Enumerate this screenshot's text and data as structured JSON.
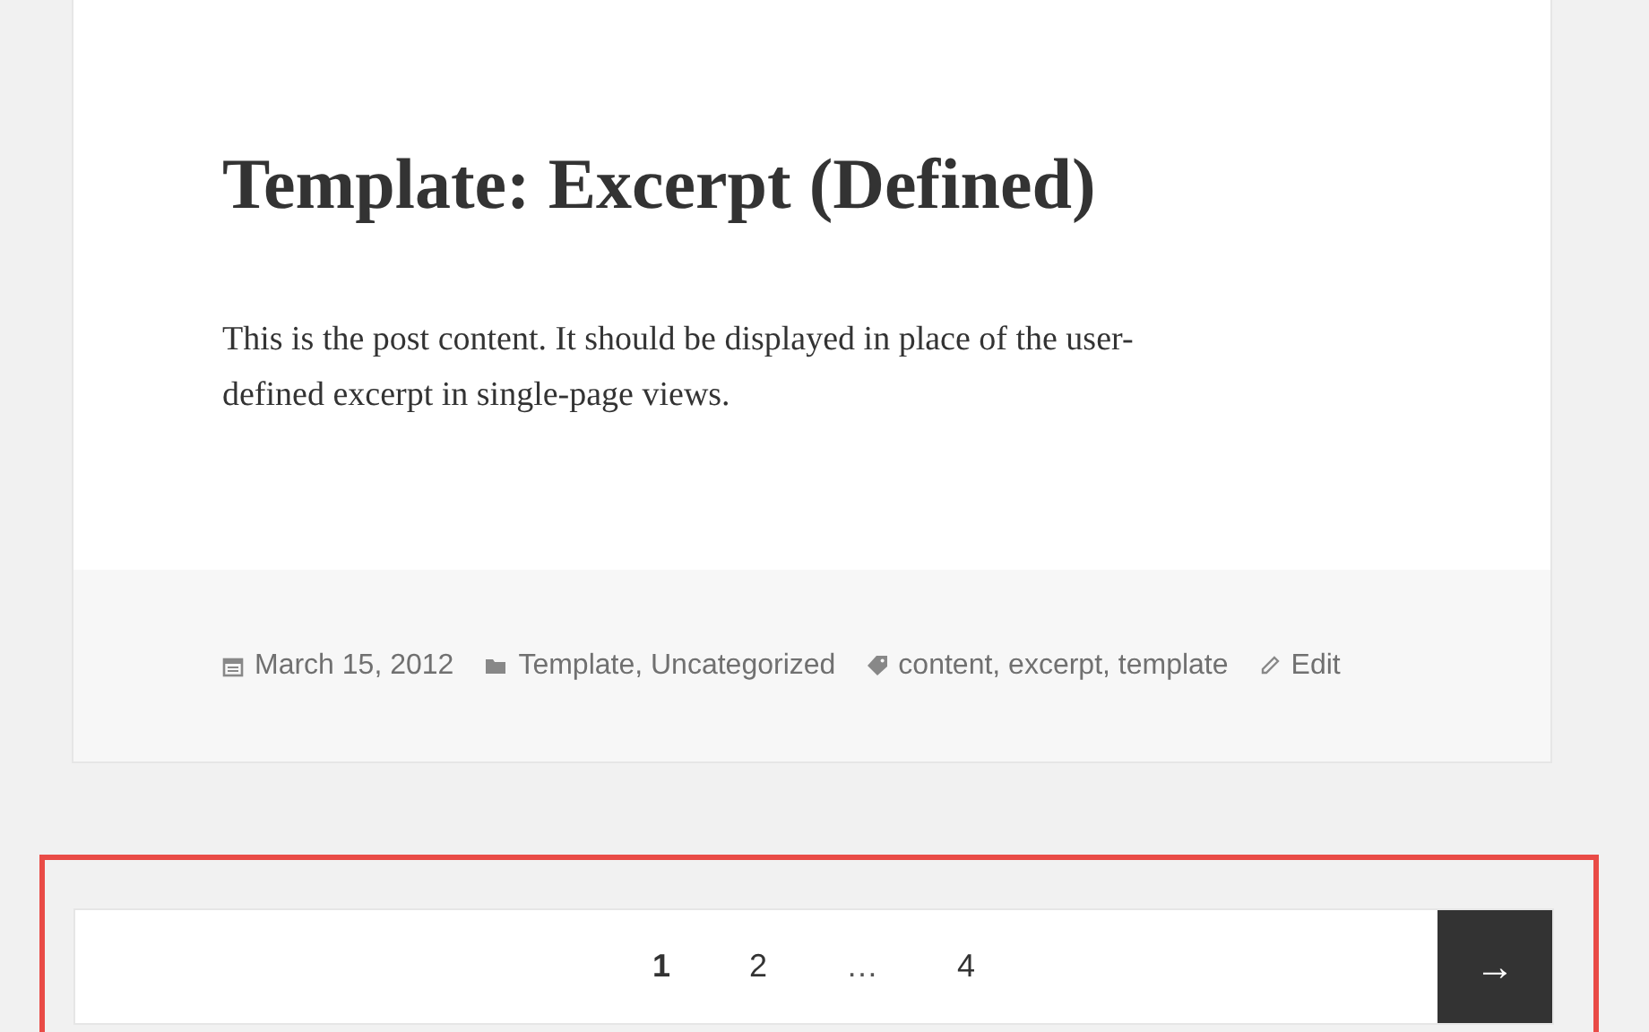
{
  "post": {
    "title": "Template: Excerpt (Defined)",
    "content": "This is the post content. It should be displayed in place of the user-defined excerpt in single-page views.",
    "meta": [
      {
        "kind": "date",
        "text": "March 15, 2012"
      },
      {
        "kind": "categories",
        "text": "Template, Uncategorized"
      },
      {
        "kind": "tags",
        "text": "content, excerpt, template"
      },
      {
        "kind": "edit",
        "text": "Edit"
      }
    ]
  },
  "pagination": {
    "pages": [
      {
        "kind": "page",
        "label": "1",
        "selected": true
      },
      {
        "kind": "page",
        "label": "2",
        "selected": false
      },
      {
        "kind": "dots",
        "label": "…",
        "selected": false
      },
      {
        "kind": "page",
        "label": "4",
        "selected": false
      }
    ],
    "next": "→"
  }
}
